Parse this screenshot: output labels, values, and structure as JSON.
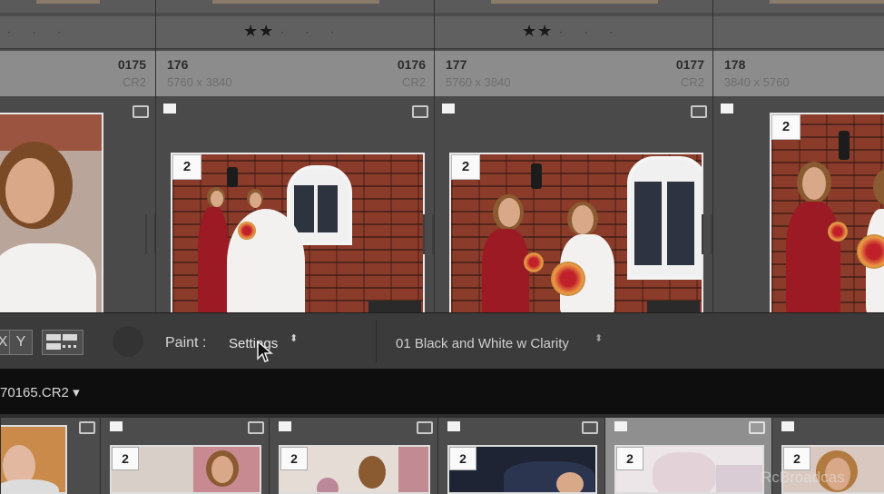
{
  "grid": {
    "cells": [
      {
        "index": "",
        "file_number": "0175",
        "dimensions": "",
        "ext": "CR2",
        "rating": 0,
        "stack": ""
      },
      {
        "index": "176",
        "file_number": "0176",
        "dimensions": "5760 x 3840",
        "ext": "CR2",
        "rating": 2,
        "stack": "2"
      },
      {
        "index": "177",
        "file_number": "0177",
        "dimensions": "5760 x 3840",
        "ext": "CR2",
        "rating": 2,
        "stack": "2"
      },
      {
        "index": "178",
        "file_number": "",
        "dimensions": "3840 x 5760",
        "ext": "",
        "rating": 0,
        "stack": "2"
      }
    ],
    "stars_filled": "★★",
    "stars_empty": "· · ·",
    "dots_only": "· · ·"
  },
  "toolbar": {
    "x_label": "X",
    "y_label": "Y",
    "paint_label": "Paint :",
    "paint_value": "Settings",
    "preset_value": "01 Black and White w Clarity",
    "updown_glyph": "⬍"
  },
  "path_bar": {
    "filename": "70165.CR2",
    "dropdown_glyph": "▾"
  },
  "filmstrip": {
    "stacks": [
      "2",
      "2",
      "2",
      "2",
      "2"
    ]
  },
  "watermark": "RcBroadcas",
  "colors": {
    "selected_cell": "#8f8f8f",
    "dress_red": "#9c1a24",
    "brick": "#8a3b2a"
  },
  "icons": {
    "flag": "flag-icon",
    "badge": "badge-icon",
    "cursor": "mouse-cursor-icon"
  }
}
